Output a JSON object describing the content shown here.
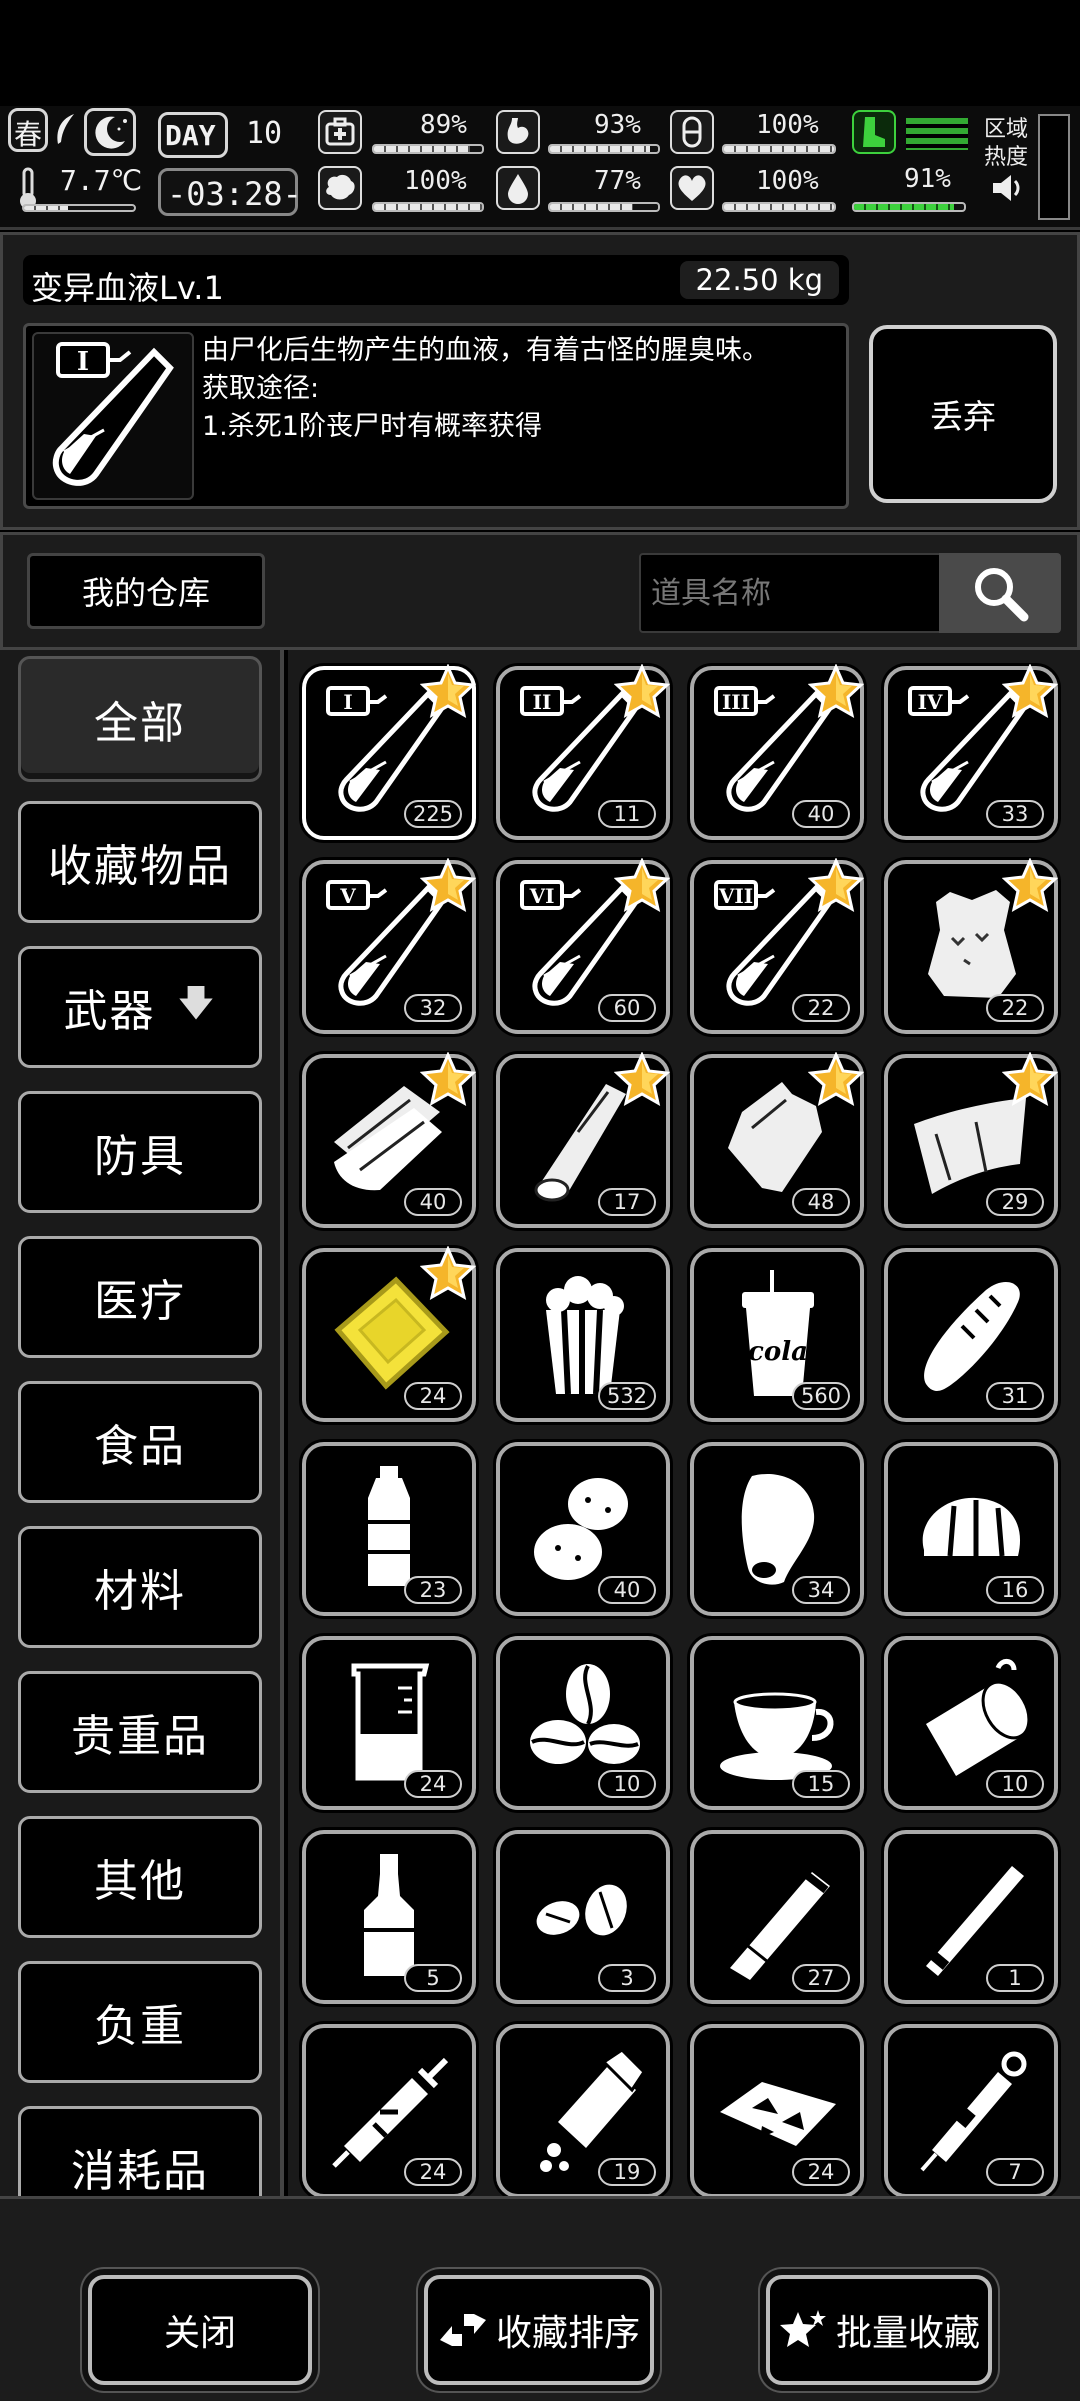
{
  "hud": {
    "season": "春",
    "temperature": "7.7℃",
    "day_label": "DAY",
    "day_number": "10",
    "clock": "-03:28-",
    "stats": [
      {
        "icon": "medkit-icon",
        "value": "89%",
        "fill": 0.89
      },
      {
        "icon": "stomach-icon",
        "value": "93%",
        "fill": 0.93
      },
      {
        "icon": "pill-icon",
        "value": "100%",
        "fill": 1.0
      },
      {
        "icon": "brain-icon",
        "value": "100%",
        "fill": 1.0
      },
      {
        "icon": "water-drop-icon",
        "value": "77%",
        "fill": 0.77
      },
      {
        "icon": "heart-icon",
        "value": "100%",
        "fill": 1.0
      }
    ],
    "stamina": {
      "value": "91%",
      "fill": 0.91
    },
    "zone_heat_label": "区域\n热度"
  },
  "detail": {
    "name": "变异血液Lv.1",
    "weight": "22.50 kg",
    "description": "由尸化后生物产生的血液，有着古怪的腥臭味。\n获取途径:\n1.杀死1阶丧尸时有概率获得",
    "icon_level": "I",
    "discard_label": "丢弃"
  },
  "warehouse": {
    "title": "我的仓库",
    "search_placeholder": "道具名称"
  },
  "categories": [
    {
      "label": "全部",
      "active": true
    },
    {
      "label": "收藏物品"
    },
    {
      "label": "武器",
      "arrow": "🡇"
    },
    {
      "label": "防具"
    },
    {
      "label": "医疗"
    },
    {
      "label": "食品"
    },
    {
      "label": "材料"
    },
    {
      "label": "贵重品"
    },
    {
      "label": "其他"
    },
    {
      "label": "负重"
    },
    {
      "label": "消耗品"
    }
  ],
  "items": [
    {
      "icon": "blood-vial-icon",
      "level": "I",
      "count": "225",
      "fav": true,
      "selected": true
    },
    {
      "icon": "blood-vial-icon",
      "level": "II",
      "count": "11",
      "fav": true
    },
    {
      "icon": "blood-vial-icon",
      "level": "III",
      "count": "40",
      "fav": true
    },
    {
      "icon": "blood-vial-icon",
      "level": "IV",
      "count": "33",
      "fav": true
    },
    {
      "icon": "blood-vial-icon",
      "level": "V",
      "count": "32",
      "fav": true
    },
    {
      "icon": "blood-vial-icon",
      "level": "VI",
      "count": "60",
      "fav": true
    },
    {
      "icon": "blood-vial-icon",
      "level": "VII",
      "count": "22",
      "fav": true
    },
    {
      "icon": "cloth-sack-icon",
      "count": "22",
      "fav": true
    },
    {
      "icon": "wood-planks-icon",
      "count": "40",
      "fav": true
    },
    {
      "icon": "wood-log-icon",
      "count": "17",
      "fav": true
    },
    {
      "icon": "leather-icon",
      "count": "48",
      "fav": true
    },
    {
      "icon": "fabric-sheet-icon",
      "count": "29",
      "fav": true
    },
    {
      "icon": "gold-bar-icon",
      "count": "24",
      "fav": true
    },
    {
      "icon": "popcorn-icon",
      "count": "532"
    },
    {
      "icon": "cola-cup-icon",
      "count": "560",
      "text": "cola"
    },
    {
      "icon": "bread-loaf-icon",
      "count": "31"
    },
    {
      "icon": "water-bottle-icon",
      "count": "23"
    },
    {
      "icon": "potatoes-icon",
      "count": "40"
    },
    {
      "icon": "raw-meat-icon",
      "count": "34"
    },
    {
      "icon": "bread-bun-icon",
      "count": "16"
    },
    {
      "icon": "beaker-icon",
      "count": "24"
    },
    {
      "icon": "coffee-beans-icon",
      "count": "10"
    },
    {
      "icon": "coffee-cup-icon",
      "count": "15"
    },
    {
      "icon": "canned-food-icon",
      "count": "10"
    },
    {
      "icon": "liquor-bottle-icon",
      "count": "5"
    },
    {
      "icon": "nuts-icon",
      "count": "3"
    },
    {
      "icon": "cigar-icon",
      "count": "27"
    },
    {
      "icon": "cigarette-icon",
      "count": "1"
    },
    {
      "icon": "syringe-icon",
      "count": "24"
    },
    {
      "icon": "pill-bottle-icon",
      "count": "19"
    },
    {
      "icon": "chips-icon",
      "count": "24"
    },
    {
      "icon": "injector-pen-icon",
      "count": "7"
    }
  ],
  "bottom": {
    "close_label": "关闭",
    "sort_label": "收藏排序",
    "batch_label": "批量收藏"
  }
}
